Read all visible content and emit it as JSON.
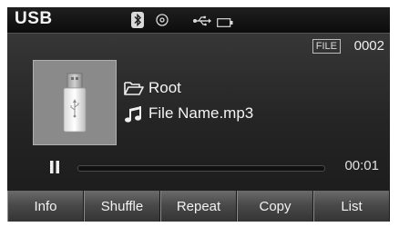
{
  "topbar": {
    "source_label": "USB",
    "icons": [
      "bluetooth-icon",
      "disc-icon",
      "usb-icon",
      "battery-icon"
    ]
  },
  "file_info": {
    "badge": "FILE",
    "number": "0002"
  },
  "now_playing": {
    "folder": "Root",
    "file": "File Name.mp3",
    "art_icon": "usb-stick-icon"
  },
  "playback": {
    "state": "paused",
    "time": "00:01",
    "progress_fraction": 0.0
  },
  "softkeys": [
    "Info",
    "Shuffle",
    "Repeat",
    "Copy",
    "List"
  ],
  "colors": {
    "background": "#242424",
    "text": "#f4f4f4",
    "art_background": "#8a8a8a"
  }
}
